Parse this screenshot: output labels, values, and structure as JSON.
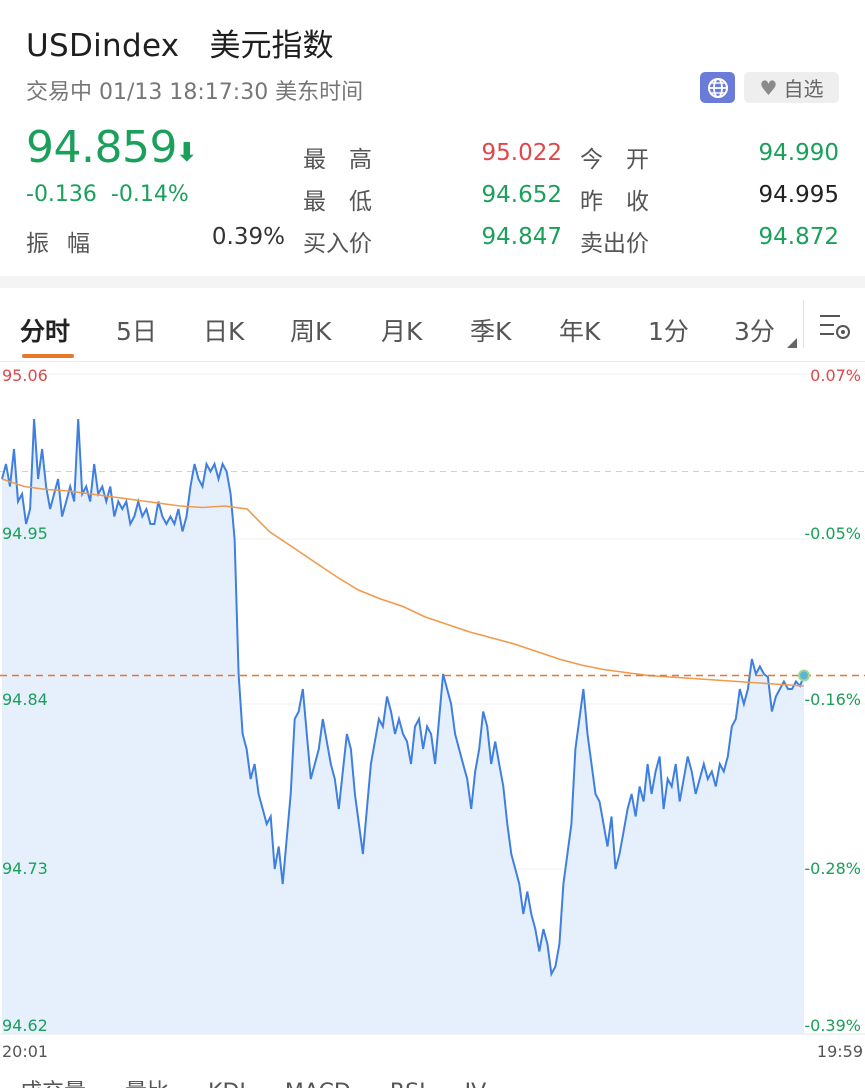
{
  "header": {
    "symbol": "USDindex",
    "name": "美元指数",
    "status_line": "交易中 01/13 18:17:30 美东时间",
    "favorite_label": "自选",
    "globe_icon": "globe-icon",
    "heart_icon": "heart-icon"
  },
  "quote": {
    "price": "94.859",
    "direction": "down",
    "change": "-0.136",
    "change_pct": "-0.14%",
    "amplitude_label": "振幅",
    "amplitude": "0.39%",
    "high_label": "最　高",
    "high": "95.022",
    "low_label": "最　低",
    "low": "94.652",
    "bid_label": "买入价",
    "bid": "94.847",
    "open_label": "今　开",
    "open": "94.990",
    "prev_close_label": "昨　收",
    "prev_close": "94.995",
    "ask_label": "卖出价",
    "ask": "94.872"
  },
  "colors": {
    "up": "#e0474c",
    "down": "#1aa05a",
    "accent": "#e8772e",
    "price_line": "#3f7fe0",
    "avg_line": "#ef9a4d",
    "fill": "#e6f0fc"
  },
  "tabs": [
    {
      "label": "分时",
      "active": true
    },
    {
      "label": "5日"
    },
    {
      "label": "日K"
    },
    {
      "label": "周K"
    },
    {
      "label": "月K"
    },
    {
      "label": "季K"
    },
    {
      "label": "年K"
    },
    {
      "label": "1分"
    },
    {
      "label": "3分"
    }
  ],
  "settings_icon": "settings-icon",
  "chart_data": {
    "type": "line",
    "x_start_label": "20:01",
    "x_end_label": "19:59",
    "ylim": [
      94.62,
      95.06
    ],
    "y_tick_labels": [
      "95.06",
      "94.95",
      "94.84",
      "94.73",
      "94.62"
    ],
    "y_ticks": [
      95.06,
      94.95,
      94.84,
      94.73,
      94.62
    ],
    "pct_tick_labels": [
      "0.07%",
      "-0.05%",
      "-0.16%",
      "-0.28%",
      "-0.39%"
    ],
    "prev_close": 94.995,
    "current_price": 94.859,
    "series": [
      {
        "name": "price",
        "values": [
          94.99,
          95.0,
          94.985,
          95.01,
          94.975,
          94.98,
          94.96,
          94.97,
          95.03,
          94.99,
          95.01,
          94.985,
          94.97,
          94.98,
          94.99,
          94.965,
          94.975,
          94.985,
          94.975,
          95.03,
          94.98,
          94.985,
          94.975,
          95.0,
          94.98,
          94.985,
          94.975,
          94.985,
          94.965,
          94.975,
          94.97,
          94.975,
          94.96,
          94.965,
          94.975,
          94.965,
          94.97,
          94.96,
          94.96,
          94.975,
          94.965,
          94.96,
          94.965,
          94.96,
          94.97,
          94.955,
          94.965,
          94.985,
          95.0,
          94.99,
          94.985,
          95.0,
          94.995,
          95.0,
          94.99,
          95.0,
          94.995,
          94.98,
          94.95,
          94.86,
          94.82,
          94.81,
          94.79,
          94.8,
          94.78,
          94.77,
          94.76,
          94.765,
          94.73,
          94.745,
          94.72,
          94.75,
          94.78,
          94.83,
          94.835,
          94.85,
          94.82,
          94.79,
          94.8,
          94.81,
          94.83,
          94.815,
          94.8,
          94.79,
          94.77,
          94.795,
          94.82,
          94.81,
          94.78,
          94.76,
          94.74,
          94.77,
          94.8,
          94.815,
          94.83,
          94.825,
          94.845,
          94.835,
          94.82,
          94.83,
          94.82,
          94.815,
          94.8,
          94.825,
          94.83,
          94.81,
          94.825,
          94.82,
          94.8,
          94.83,
          94.86,
          94.85,
          94.84,
          94.82,
          94.81,
          94.8,
          94.79,
          94.77,
          94.795,
          94.81,
          94.835,
          94.825,
          94.8,
          94.815,
          94.8,
          94.785,
          94.76,
          94.74,
          94.73,
          94.72,
          94.7,
          94.715,
          94.7,
          94.69,
          94.675,
          94.69,
          94.68,
          94.66,
          94.665,
          94.68,
          94.72,
          94.74,
          94.76,
          94.81,
          94.83,
          94.85,
          94.82,
          94.8,
          94.78,
          94.775,
          94.76,
          94.745,
          94.765,
          94.73,
          94.74,
          94.755,
          94.77,
          94.78,
          94.765,
          94.785,
          94.775,
          94.8,
          94.78,
          94.795,
          94.805,
          94.77,
          94.79,
          94.785,
          94.8,
          94.775,
          94.79,
          94.805,
          94.795,
          94.78,
          94.79,
          94.8,
          94.79,
          94.795,
          94.785,
          94.8,
          94.795,
          94.805,
          94.825,
          94.83,
          94.85,
          94.84,
          94.85,
          94.87,
          94.86,
          94.865,
          94.86,
          94.858,
          94.835,
          94.845,
          94.85,
          94.855,
          94.85,
          94.85,
          94.855,
          94.852,
          94.859
        ]
      },
      {
        "name": "average",
        "values": [
          94.99,
          94.985,
          94.983,
          94.982,
          94.98,
          94.978,
          94.976,
          94.974,
          94.972,
          94.971,
          94.972,
          94.97,
          94.955,
          94.945,
          94.935,
          94.925,
          94.916,
          94.91,
          94.905,
          94.898,
          94.893,
          94.888,
          94.884,
          94.88,
          94.875,
          94.87,
          94.866,
          94.863,
          94.861,
          94.859,
          94.858,
          94.857,
          94.856,
          94.855,
          94.854,
          94.853,
          94.852
        ]
      }
    ]
  },
  "bottom_tabs": [
    "成交量",
    "量比",
    "KDJ",
    "MACD",
    "RSI",
    "IV"
  ]
}
